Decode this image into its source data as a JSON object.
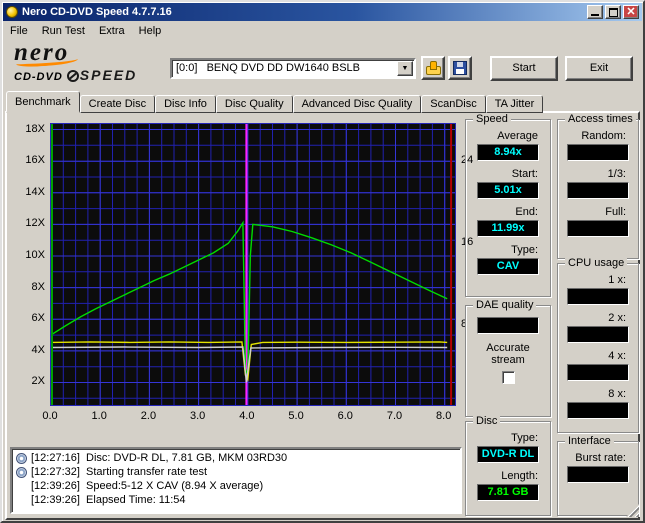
{
  "window": {
    "title": "Nero CD-DVD Speed 4.7.7.16"
  },
  "menu": {
    "items": [
      "File",
      "Run Test",
      "Extra",
      "Help"
    ]
  },
  "toolbar": {
    "logo": {
      "brand": "nero",
      "sub1": "CD-DVD",
      "sub2": "SPEED"
    },
    "drive_select": "[0:0]   BENQ DVD DD DW1640 BSLB",
    "start_label": "Start",
    "exit_label": "Exit"
  },
  "tabs": {
    "items": [
      "Benchmark",
      "Create Disc",
      "Disc Info",
      "Disc Quality",
      "Advanced Disc Quality",
      "ScanDisc",
      "TA Jitter"
    ],
    "active": "Benchmark"
  },
  "panels": {
    "speed": {
      "title": "Speed",
      "fields": [
        {
          "label": "Average",
          "value": "8.94x"
        },
        {
          "label": "Start:",
          "value": "5.01x"
        },
        {
          "label": "End:",
          "value": "11.99x"
        },
        {
          "label": "Type:",
          "value": "CAV"
        }
      ]
    },
    "access": {
      "title": "Access times",
      "fields": [
        {
          "label": "Random:",
          "value": ""
        },
        {
          "label": "1/3:",
          "value": ""
        },
        {
          "label": "Full:",
          "value": ""
        }
      ]
    },
    "cpu": {
      "title": "CPU usage",
      "fields": [
        {
          "label": "1 x:",
          "value": ""
        },
        {
          "label": "2 x:",
          "value": ""
        },
        {
          "label": "4 x:",
          "value": ""
        },
        {
          "label": "8 x:",
          "value": ""
        }
      ]
    },
    "dae": {
      "title": "DAE quality",
      "value": "",
      "checkbox_label": "Accurate stream",
      "checked": false
    },
    "disc": {
      "title": "Disc",
      "fields": [
        {
          "label": "Type:",
          "value": "DVD-R DL",
          "color": "#00ffff"
        },
        {
          "label": "Length:",
          "value": "7.81 GB",
          "color": "#00ff00"
        }
      ]
    },
    "interface": {
      "title": "Interface",
      "fields": [
        {
          "label": "Burst rate:",
          "value": ""
        }
      ]
    }
  },
  "log": {
    "lines": [
      {
        "icon": "disc",
        "text": "[12:27:16]  Disc: DVD-R DL, 7.81 GB, MKM 03RD30"
      },
      {
        "icon": "disc",
        "text": "[12:27:32]  Starting transfer rate test"
      },
      {
        "icon": "",
        "text": "[12:39:26]  Speed:5-12 X CAV (8.94 X average)"
      },
      {
        "icon": "",
        "text": "[12:39:26]  Elapsed Time: 11:54"
      }
    ]
  },
  "chart_data": {
    "type": "line",
    "title": "Transfer rate benchmark (speed X vs GB read)",
    "x_axis": {
      "min": 0,
      "max": 8.25,
      "minor_step": 0.25,
      "tick_values": [
        0,
        1,
        2,
        3,
        4,
        5,
        6,
        7,
        8
      ],
      "tick_labels": [
        "0.0",
        "1.0",
        "2.0",
        "3.0",
        "4.0",
        "5.0",
        "6.0",
        "7.0",
        "8.0"
      ]
    },
    "y_axis_left": {
      "min": 0.45,
      "max": 18.35,
      "minor_step": 1,
      "tick_values": [
        18,
        16,
        14,
        12,
        10,
        8,
        6,
        4,
        2
      ],
      "tick_labels": [
        "18X",
        "16X",
        "14X",
        "12X",
        "10X",
        "8X",
        "6X",
        "4X",
        "2X"
      ]
    },
    "y_axis_right": {
      "min": 0,
      "max": 27.6,
      "tick_values": [
        24,
        16,
        8
      ],
      "tick_labels": [
        "24",
        "16",
        "8"
      ]
    },
    "plot_bg": "#0c0c0c",
    "grid_color": "#2121b0",
    "grid_major_color": "#3535d6",
    "axis_color_left": "#00a000",
    "axis_color_bottom": "#009d9d",
    "series": [
      {
        "name": "read-speed",
        "color": "#00db00",
        "axis": "left",
        "points": [
          [
            0,
            5.01
          ],
          [
            0.3,
            5.6
          ],
          [
            0.6,
            6.15
          ],
          [
            0.9,
            6.65
          ],
          [
            1.2,
            7.1
          ],
          [
            1.5,
            7.55
          ],
          [
            1.8,
            8.0
          ],
          [
            2.1,
            8.45
          ],
          [
            2.4,
            8.85
          ],
          [
            2.7,
            9.3
          ],
          [
            3.0,
            9.75
          ],
          [
            3.3,
            10.2
          ],
          [
            3.6,
            10.8
          ],
          [
            3.8,
            11.6
          ],
          [
            3.9,
            12.1
          ],
          [
            3.95,
            2.9
          ],
          [
            4.0,
            2.4
          ],
          [
            4.05,
            10.0
          ],
          [
            4.1,
            12.0
          ],
          [
            4.5,
            11.85
          ],
          [
            4.9,
            11.55
          ],
          [
            5.3,
            11.15
          ],
          [
            5.7,
            10.7
          ],
          [
            6.1,
            10.2
          ],
          [
            6.5,
            9.6
          ],
          [
            6.9,
            9.0
          ],
          [
            7.3,
            8.4
          ],
          [
            7.7,
            7.8
          ],
          [
            8.05,
            7.3
          ]
        ]
      },
      {
        "name": "rotation-speed",
        "color": "#e3e300",
        "axis": "right",
        "points": [
          [
            0,
            6.3
          ],
          [
            0.8,
            6.35
          ],
          [
            1.6,
            6.3
          ],
          [
            2.4,
            6.35
          ],
          [
            3.2,
            6.3
          ],
          [
            3.88,
            6.35
          ],
          [
            3.95,
            3.1
          ],
          [
            4.0,
            2.7
          ],
          [
            4.07,
            6.1
          ],
          [
            4.3,
            6.3
          ],
          [
            5.0,
            6.32
          ],
          [
            6.0,
            6.3
          ],
          [
            7.0,
            6.32
          ],
          [
            7.9,
            6.35
          ],
          [
            8.05,
            6.3
          ]
        ]
      },
      {
        "name": "secondary-line",
        "color": "#cfcfcf",
        "axis": "right",
        "points": [
          [
            0,
            5.8
          ],
          [
            1.5,
            5.85
          ],
          [
            3.0,
            5.8
          ],
          [
            3.9,
            5.85
          ],
          [
            3.97,
            2.4
          ],
          [
            4.06,
            5.75
          ],
          [
            5.5,
            5.8
          ],
          [
            7.0,
            5.82
          ],
          [
            8.05,
            5.8
          ]
        ]
      }
    ],
    "markers": [
      {
        "name": "layer-break-line",
        "x": 3.97,
        "color": "#ff22ff"
      },
      {
        "name": "end-line",
        "x": 8.13,
        "color": "#b40000"
      }
    ]
  }
}
